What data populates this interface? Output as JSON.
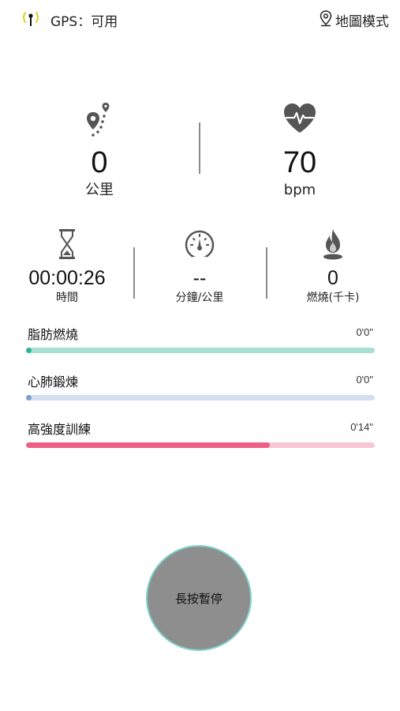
{
  "status_bar": {
    "gps_label": "GPS：可用",
    "map_mode_label": "地圖模式",
    "gps_icon": "gps-signal-icon",
    "map_icon": "map-pin-icon"
  },
  "distance": {
    "value": "0",
    "unit": "公里",
    "icon": "route-icon"
  },
  "heart_rate": {
    "value": "70",
    "unit": "bpm",
    "icon": "heart-pulse-icon"
  },
  "duration": {
    "value": "00:00:26",
    "label": "時間",
    "icon": "hourglass-icon"
  },
  "pace": {
    "value": "--",
    "label": "分鐘/公里",
    "icon": "speedometer-icon"
  },
  "calories": {
    "value": "0",
    "label": "燃燒(千卡)",
    "icon": "flame-icon"
  },
  "zones": [
    {
      "label": "脂肪燃燒",
      "time": "0'0\"",
      "progress": 0.0,
      "color": "#a8e0d3",
      "accent": "#2fb59a"
    },
    {
      "label": "心肺鍛煉",
      "time": "0'0\"",
      "progress": 0.0,
      "color": "#d3dff0",
      "accent": "#7f9fcf"
    },
    {
      "label": "高強度訓練",
      "time": "0'14\"",
      "progress": 0.7,
      "color": "#f7c6d3",
      "accent": "#ee5f84"
    }
  ],
  "pause_button": {
    "label": "長按暫停"
  },
  "colors": {
    "gps_accent": "#e0d020",
    "icon_gray": "#555555",
    "button_ring": "#7fd3cc"
  }
}
